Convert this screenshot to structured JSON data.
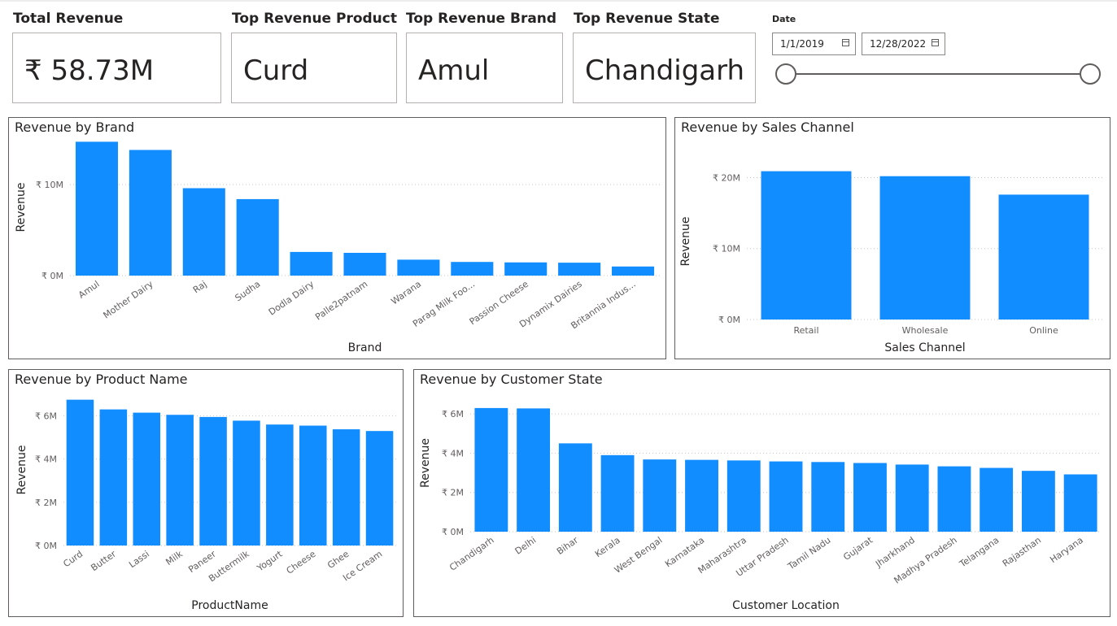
{
  "kpis": [
    {
      "title": "Total Revenue",
      "value": "₹ 58.73M"
    },
    {
      "title": "Top Revenue Product",
      "value": "Curd"
    },
    {
      "title": "Top Revenue Brand",
      "value": "Amul"
    },
    {
      "title": "Top Revenue State",
      "value": "Chandigarh"
    }
  ],
  "date_filter": {
    "label": "Date",
    "start": "1/1/2019",
    "end": "12/28/2022",
    "slider_start_fraction": 0,
    "slider_end_fraction": 1
  },
  "colors": {
    "bar": "#118DFF",
    "gridline": "#c8c6c4"
  },
  "chart_data": [
    {
      "id": "brand",
      "type": "bar",
      "title": "Revenue by Brand",
      "xlabel": "Brand",
      "ylabel": "Revenue",
      "ylim": [
        0,
        15
      ],
      "yticks": [
        0,
        10
      ],
      "ytick_labels": [
        "₹ 0M",
        "₹ 10M"
      ],
      "categories": [
        "Amul",
        "Mother Dairy",
        "Raj",
        "Sudha",
        "Dodla Dairy",
        "Palle2patnam",
        "Warana",
        "Parag Milk Foo...",
        "Passion Cheese",
        "Dynamix Dairies",
        "Britannia Indus..."
      ],
      "values": [
        14.7,
        13.8,
        9.6,
        8.4,
        2.6,
        2.5,
        1.75,
        1.5,
        1.45,
        1.42,
        1.0
      ],
      "units": "₹ M",
      "grid": true
    },
    {
      "id": "channel",
      "type": "bar",
      "title": "Revenue by Sales Channel",
      "xlabel": "Sales Channel",
      "ylabel": "Revenue",
      "ylim": [
        0,
        22
      ],
      "yticks": [
        0,
        10,
        20
      ],
      "ytick_labels": [
        "₹ 0M",
        "₹ 10M",
        "₹ 20M"
      ],
      "categories": [
        "Retail",
        "Wholesale",
        "Online"
      ],
      "values": [
        20.9,
        20.2,
        17.6
      ],
      "units": "₹ M",
      "grid": true
    },
    {
      "id": "product",
      "type": "bar",
      "title": "Revenue by Product Name",
      "xlabel": "ProductName",
      "ylabel": "Revenue",
      "ylim": [
        0,
        7
      ],
      "yticks": [
        0,
        2,
        4,
        6
      ],
      "ytick_labels": [
        "₹ 0M",
        "₹ 2M",
        "₹ 4M",
        "₹ 6M"
      ],
      "categories": [
        "Curd",
        "Butter",
        "Lassi",
        "Milk",
        "Paneer",
        "Buttermilk",
        "Yogurt",
        "Cheese",
        "Ghee",
        "Ice Cream"
      ],
      "values": [
        6.75,
        6.3,
        6.15,
        6.05,
        5.95,
        5.78,
        5.6,
        5.55,
        5.38,
        5.3
      ],
      "units": "₹ M",
      "grid": true
    },
    {
      "id": "state",
      "type": "bar",
      "title": "Revenue by Customer State",
      "xlabel": "Customer Location",
      "ylabel": "Revenue",
      "ylim": [
        0,
        7
      ],
      "yticks": [
        0,
        2,
        4,
        6
      ],
      "ytick_labels": [
        "₹ 0M",
        "₹ 2M",
        "₹ 4M",
        "₹ 6M"
      ],
      "categories": [
        "Chandigarh",
        "Delhi",
        "Bihar",
        "Kerala",
        "West Bengal",
        "Karnataka",
        "Maharashtra",
        "Uttar Pradesh",
        "Tamil Nadu",
        "Gujarat",
        "Jharkhand",
        "Madhya Pradesh",
        "Telangana",
        "Rajasthan",
        "Haryana"
      ],
      "values": [
        6.3,
        6.28,
        4.5,
        3.9,
        3.68,
        3.66,
        3.63,
        3.58,
        3.55,
        3.5,
        3.42,
        3.33,
        3.25,
        3.1,
        2.92
      ],
      "units": "₹ M",
      "grid": true
    }
  ]
}
